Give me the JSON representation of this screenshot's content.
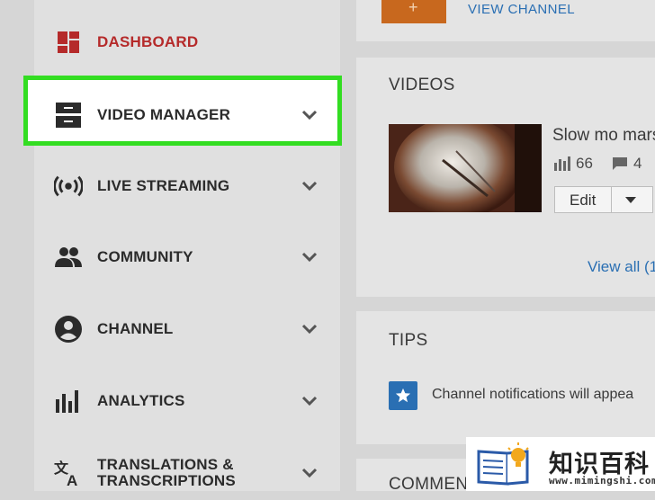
{
  "sidebar": {
    "items": [
      {
        "label": "DASHBOARD",
        "icon": "dashboard-icon"
      },
      {
        "label": "VIDEO MANAGER",
        "icon": "video-manager-icon"
      },
      {
        "label": "LIVE STREAMING",
        "icon": "live-streaming-icon"
      },
      {
        "label": "COMMUNITY",
        "icon": "community-icon"
      },
      {
        "label": "CHANNEL",
        "icon": "channel-icon"
      },
      {
        "label": "ANALYTICS",
        "icon": "analytics-icon"
      },
      {
        "label": "TRANSLATIONS &\nTRANSCRIPTIONS",
        "icon": "translate-icon"
      }
    ],
    "active_color": "#b52a2a",
    "highlight_color": "#33dd22"
  },
  "channel_card": {
    "add_label": "+",
    "view_channel_label": "VIEW CHANNEL"
  },
  "videos_card": {
    "title": "VIDEOS",
    "video": {
      "title": "Slow mo mars",
      "views": "66",
      "comments": "4"
    },
    "edit_label": "Edit",
    "view_all_label": "View all (1"
  },
  "tips_card": {
    "title": "TIPS",
    "tip_text": "Channel notifications will appea"
  },
  "comments_card": {
    "title": "COMMENTS"
  },
  "watermark": {
    "name": "知识百科",
    "url": "www.mimingshi.com"
  },
  "colors": {
    "link": "#2a6fb3",
    "accent_orange": "#c8681e"
  }
}
